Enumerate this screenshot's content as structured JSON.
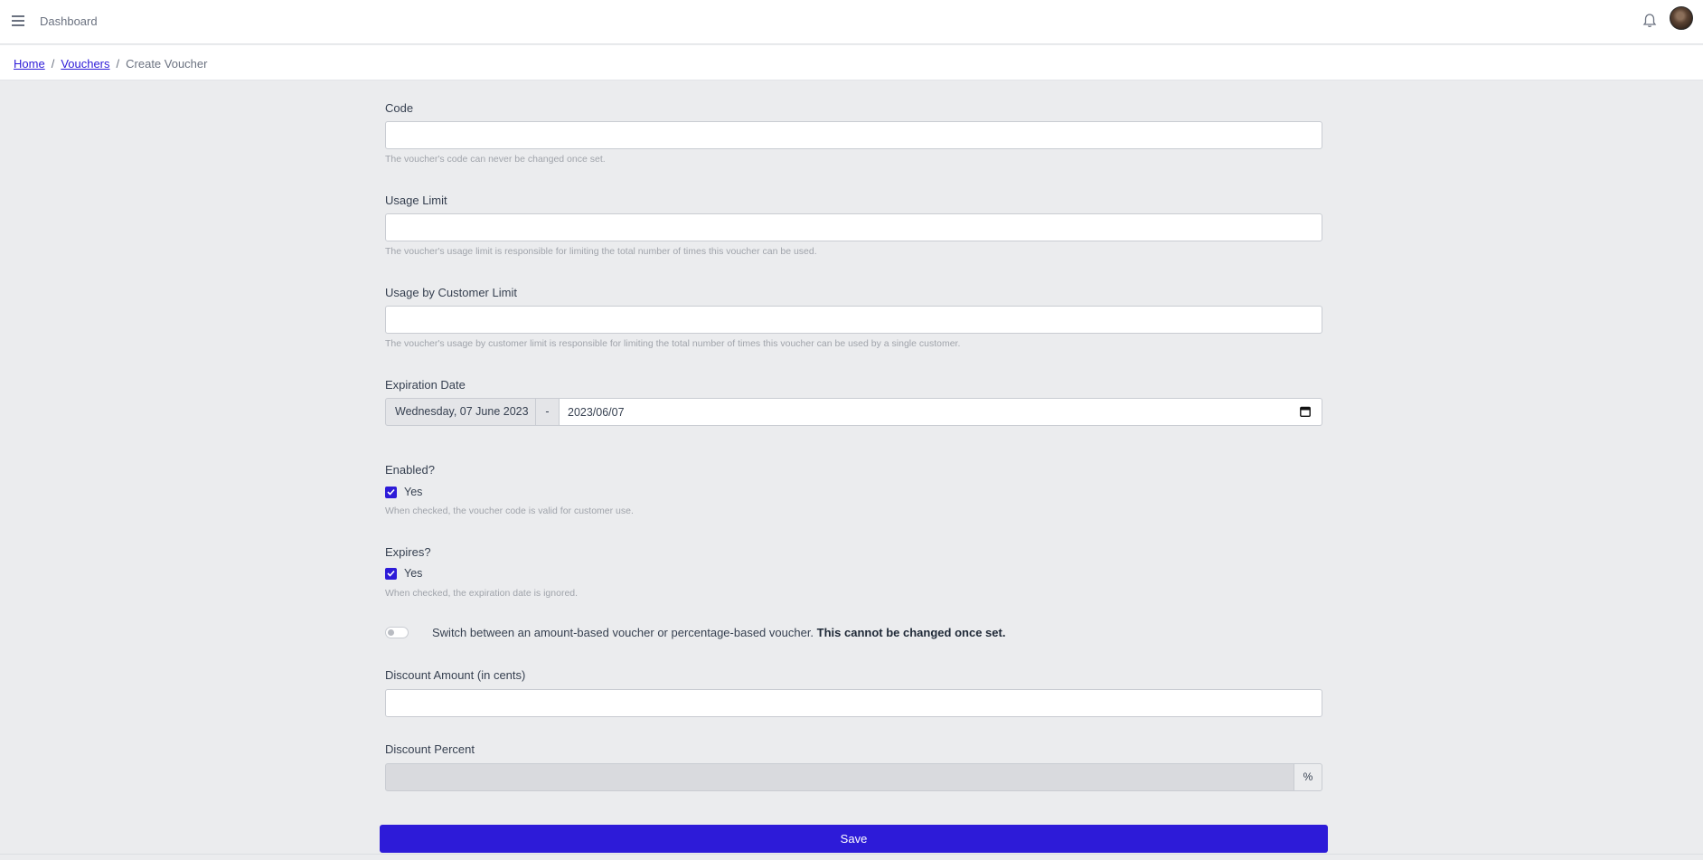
{
  "header": {
    "title": "Dashboard"
  },
  "breadcrumb": {
    "home": "Home",
    "vouchers": "Vouchers",
    "current": "Create Voucher",
    "separator": "/"
  },
  "form": {
    "code": {
      "label": "Code",
      "value": "",
      "help": "The voucher's code can never be changed once set."
    },
    "usage_limit": {
      "label": "Usage Limit",
      "value": "",
      "help": "The voucher's usage limit is responsible for limiting the total number of times this voucher can be used."
    },
    "usage_by_customer": {
      "label": "Usage by Customer Limit",
      "value": "",
      "help": "The voucher's usage by customer limit is responsible for limiting the total number of times this voucher can be used by a single customer."
    },
    "expiration": {
      "label": "Expiration Date",
      "display": "Wednesday, 07 June 2023",
      "separator": "-",
      "value": "2023/06/07"
    },
    "enabled": {
      "label": "Enabled?",
      "option": "Yes",
      "checked": true,
      "help": "When checked, the voucher code is valid for customer use."
    },
    "expires": {
      "label": "Expires?",
      "option": "Yes",
      "checked": true,
      "help": "When checked, the expiration date is ignored."
    },
    "type_switch": {
      "on": false,
      "text": "Switch between an amount-based voucher or percentage-based voucher.",
      "warning": "This cannot be changed once set."
    },
    "discount_amount": {
      "label": "Discount Amount (in cents)",
      "value": ""
    },
    "discount_percent": {
      "label": "Discount Percent",
      "value": "",
      "suffix": "%",
      "disabled": true
    },
    "save_label": "Save"
  },
  "colors": {
    "accent": "#2d1bd8",
    "background": "#ebecee"
  },
  "icons": {
    "menu": "hamburger-icon",
    "notifications": "bell-icon",
    "calendar": "calendar-icon",
    "check": "checkmark-icon"
  }
}
